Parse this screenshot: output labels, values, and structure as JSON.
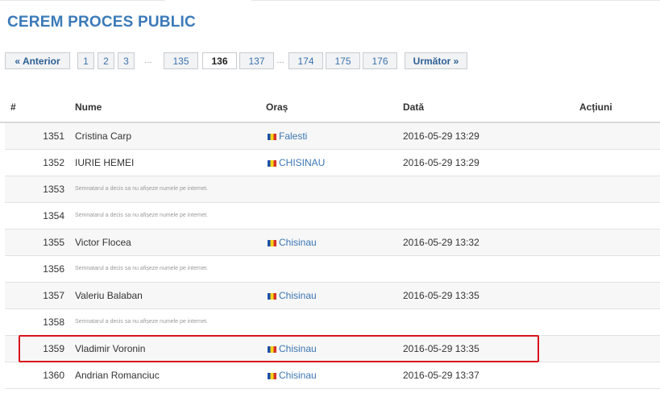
{
  "title": "CEREM PROCES PUBLIC",
  "pagination": {
    "prev": "« Anterior",
    "pages": [
      "1",
      "2",
      "3",
      "135",
      "136",
      "137",
      "174",
      "175",
      "176"
    ],
    "ellipsis": "...",
    "current": "136",
    "next": "Următor »"
  },
  "table": {
    "headers": {
      "num": "#",
      "name": "Nume",
      "city": "Oraș",
      "date": "Dată",
      "actions": "Acțiuni"
    },
    "rows": [
      {
        "num": "1351",
        "name": "Cristina Carp",
        "city": "Falesti",
        "date": "2016-05-29 13:29"
      },
      {
        "num": "1352",
        "name": "IURIE HEMEI",
        "city": "CHISINAU",
        "date": "2016-05-29 13:29"
      },
      {
        "num": "1353",
        "hidden": "Semnatarul a decis sa nu afișeze numele pe internet."
      },
      {
        "num": "1354",
        "hidden": "Semnatarul a decis sa nu afișeze numele pe internet."
      },
      {
        "num": "1355",
        "name": "Victor Flocea",
        "city": "Chisinau",
        "date": "2016-05-29 13:32"
      },
      {
        "num": "1356",
        "hidden": "Semnatarul a decis sa nu afișeze numele pe internet."
      },
      {
        "num": "1357",
        "name": "Valeriu Balaban",
        "city": "Chisinau",
        "date": "2016-05-29 13:35"
      },
      {
        "num": "1358",
        "hidden": "Semnatarul a decis sa nu afișeze numele pe internet."
      },
      {
        "num": "1359",
        "name": "Vladimir Voronin",
        "city": "Chisinau",
        "date": "2016-05-29 13:35"
      },
      {
        "num": "1360",
        "name": "Andrian Romanciuc",
        "city": "Chisinau",
        "date": "2016-05-29 13:37"
      }
    ]
  },
  "flag_icon": "moldova-flag-icon",
  "colors": {
    "title": "#3b7ab8",
    "link": "#3b76b3",
    "highlight": "#d8151b"
  }
}
